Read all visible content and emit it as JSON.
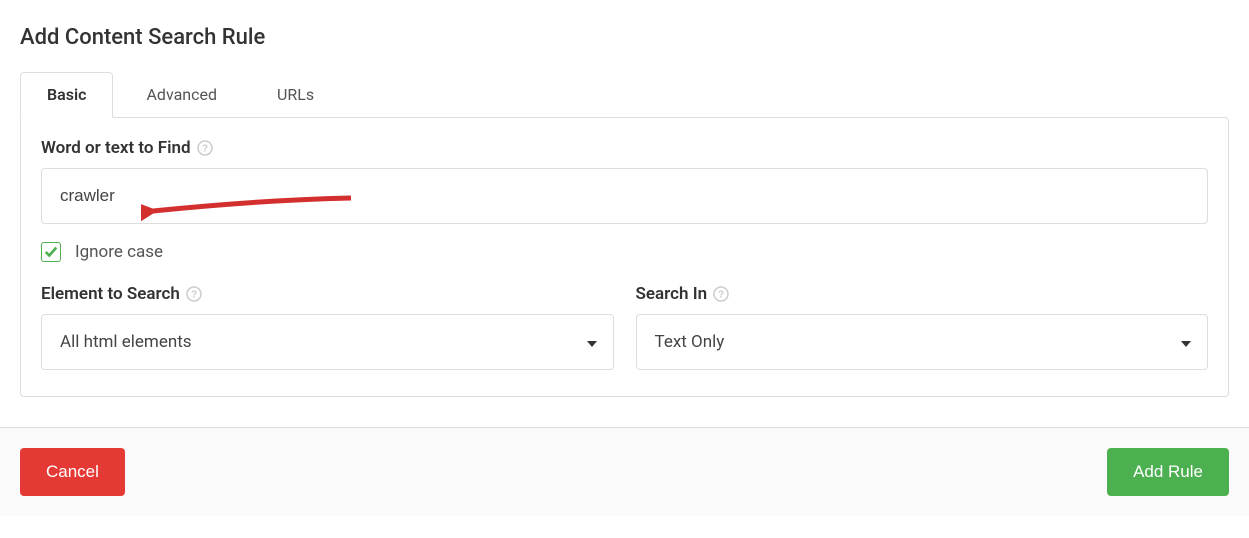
{
  "page": {
    "title": "Add Content Search Rule"
  },
  "tabs": {
    "items": [
      {
        "label": "Basic",
        "active": true
      },
      {
        "label": "Advanced",
        "active": false
      },
      {
        "label": "URLs",
        "active": false
      }
    ]
  },
  "form": {
    "word_to_find": {
      "label": "Word or text to Find",
      "value": "crawler"
    },
    "ignore_case": {
      "label": "Ignore case",
      "checked": true
    },
    "element_to_search": {
      "label": "Element to Search",
      "selected": "All html elements"
    },
    "search_in": {
      "label": "Search In",
      "selected": "Text Only"
    }
  },
  "buttons": {
    "cancel": "Cancel",
    "add_rule": "Add Rule"
  }
}
